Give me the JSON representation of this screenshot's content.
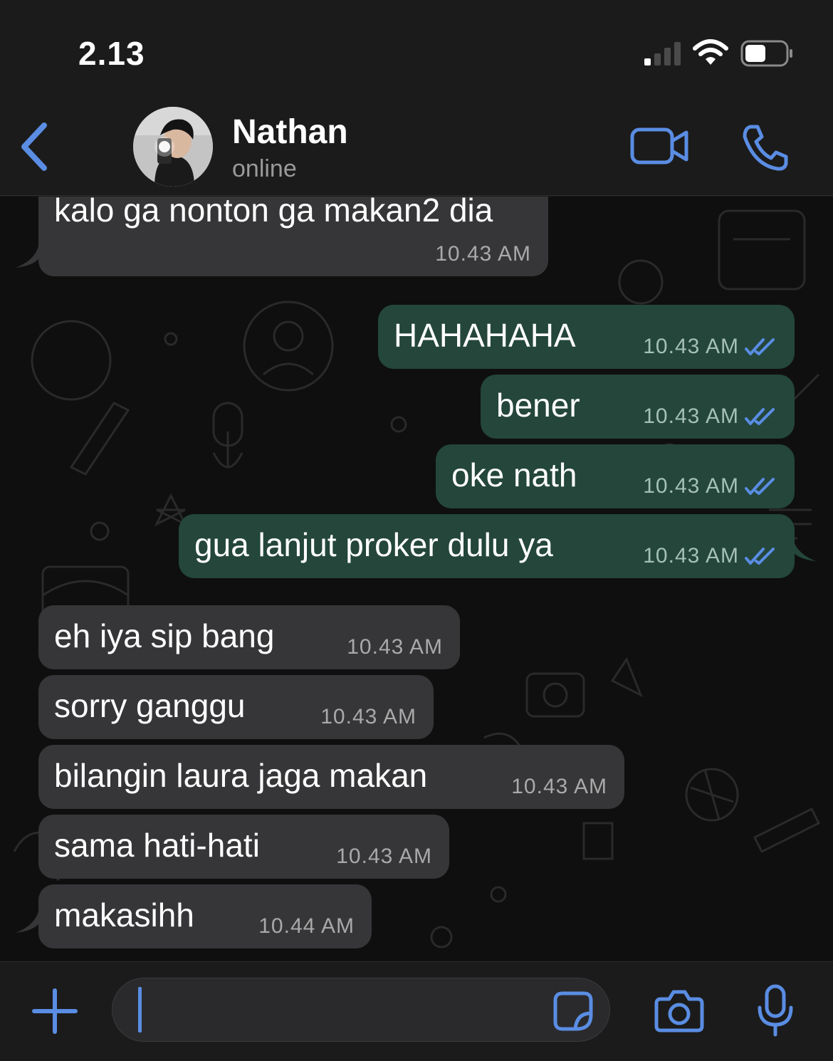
{
  "status_bar": {
    "time": "2.13"
  },
  "header": {
    "contact_name": "Nathan",
    "contact_status": "online"
  },
  "colors": {
    "accent": "#5a8de3",
    "incoming_bubble": "#363638",
    "outgoing_bubble": "#24463b",
    "read_ticks": "#5a8de3"
  },
  "messages": [
    {
      "direction": "in",
      "text": "kalo ga nonton ga makan2 dia",
      "time": "10.43 AM"
    },
    {
      "direction": "out",
      "text": "HAHAHAHA",
      "time": "10.43 AM",
      "status": "read"
    },
    {
      "direction": "out",
      "text": "bener",
      "time": "10.43 AM",
      "status": "read"
    },
    {
      "direction": "out",
      "text": "oke nath",
      "time": "10.43 AM",
      "status": "read"
    },
    {
      "direction": "out",
      "text": "gua lanjut proker dulu ya",
      "time": "10.43 AM",
      "status": "read"
    },
    {
      "direction": "in",
      "text": "eh iya sip bang",
      "time": "10.43 AM"
    },
    {
      "direction": "in",
      "text": "sorry ganggu",
      "time": "10.43 AM"
    },
    {
      "direction": "in",
      "text": "bilangin laura jaga makan",
      "time": "10.43 AM"
    },
    {
      "direction": "in",
      "text": "sama hati-hati",
      "time": "10.43 AM"
    },
    {
      "direction": "in",
      "text": "makasihh",
      "time": "10.44 AM"
    }
  ],
  "input": {
    "value": ""
  },
  "icons": {
    "back": "chevron-left-icon",
    "video": "video-camera-icon",
    "call": "phone-icon",
    "add": "plus-icon",
    "sticker": "sticker-icon",
    "camera": "camera-icon",
    "mic": "microphone-icon",
    "read": "double-check-icon"
  }
}
